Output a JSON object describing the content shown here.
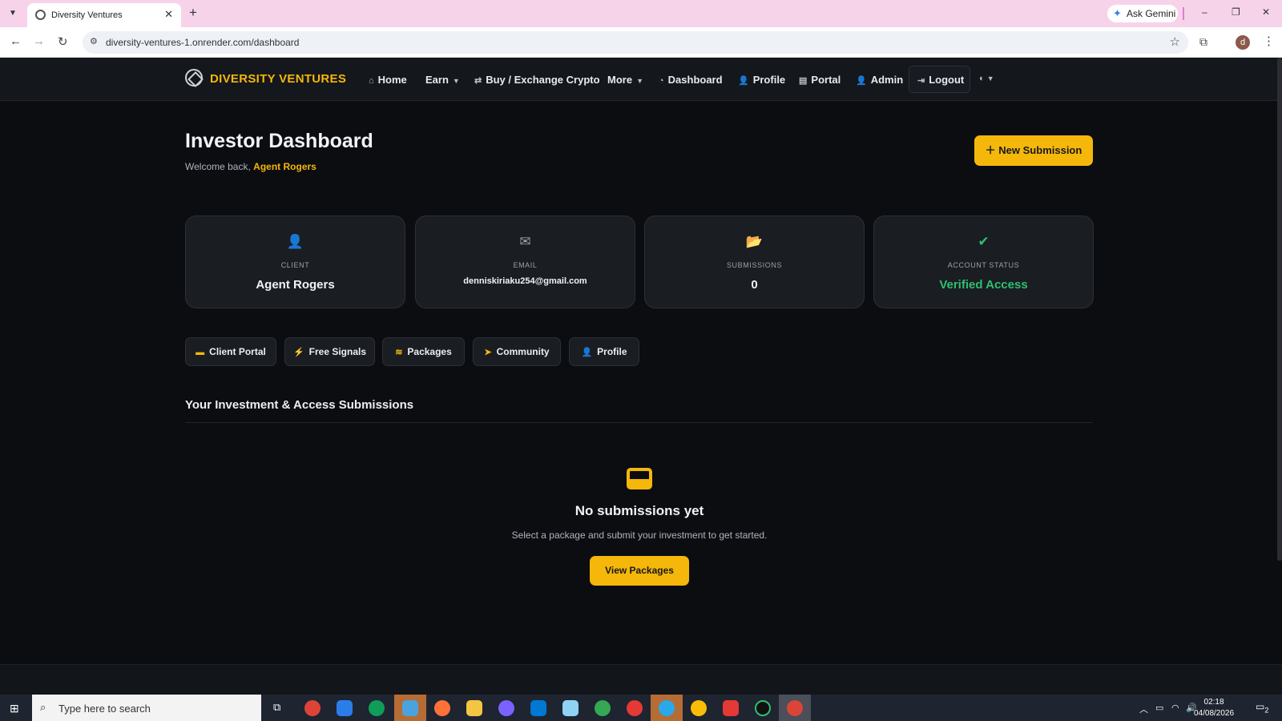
{
  "browser": {
    "tab_title": "Diversity Ventures",
    "tab_close": "✕",
    "new_tab": "+",
    "url": "diversity-ventures-1.onrender.com/dashboard",
    "ask_gemini": "Ask Gemini",
    "profile_initial": "d",
    "window_controls": [
      "–",
      "❐",
      "✕"
    ]
  },
  "nav": {
    "brand": "DIVERSITY VENTURES",
    "items": [
      {
        "label": "Home",
        "icon": "home-icon"
      },
      {
        "label": "Earn",
        "icon": "",
        "dropdown": true
      },
      {
        "label": "Buy / Exchange Crypto",
        "icon": "exchange-icon"
      },
      {
        "label": "More",
        "icon": "",
        "dropdown": true
      },
      {
        "label": "Dashboard",
        "icon": "dashboard-icon"
      },
      {
        "label": "Profile",
        "icon": "user-gear-icon"
      },
      {
        "label": "Portal",
        "icon": "portal-icon"
      },
      {
        "label": "Admin",
        "icon": "admin-icon"
      },
      {
        "label": "Logout",
        "icon": "logout-icon"
      }
    ]
  },
  "header": {
    "title": "Investor Dashboard",
    "welcome_prefix": "Welcome back,",
    "welcome_name": "Agent Rogers",
    "new_submission": "New Submission"
  },
  "cards": [
    {
      "label": "CLIENT",
      "value": "Agent Rogers",
      "icon": "user-icon"
    },
    {
      "label": "EMAIL",
      "value": "denniskiriaku254@gmail.com",
      "icon": "envelope-icon"
    },
    {
      "label": "SUBMISSIONS",
      "value": "0",
      "icon": "folder-open-icon"
    },
    {
      "label": "ACCOUNT STATUS",
      "value": "Verified Access",
      "icon": "check-circle-icon"
    }
  ],
  "quick_links": [
    {
      "label": "Client Portal",
      "icon": "portal-icon"
    },
    {
      "label": "Free Signals",
      "icon": "bolt-icon"
    },
    {
      "label": "Packages",
      "icon": "layers-icon"
    },
    {
      "label": "Community",
      "icon": "telegram-icon"
    },
    {
      "label": "Profile",
      "icon": "user-gear-icon"
    }
  ],
  "submissions": {
    "section_title": "Your Investment & Access Submissions",
    "empty_title": "No submissions yet",
    "empty_sub": "Select a package and submit your investment to get started.",
    "view_packages": "View Packages"
  },
  "taskbar": {
    "search_placeholder": "Type here to search",
    "time": "02:18",
    "date": "04/08/2026",
    "notifications": "2"
  },
  "colors": {
    "accent": "#f5b70a",
    "success": "#2fbf71",
    "background": "#0b0d11",
    "card": "#1a1d22"
  }
}
